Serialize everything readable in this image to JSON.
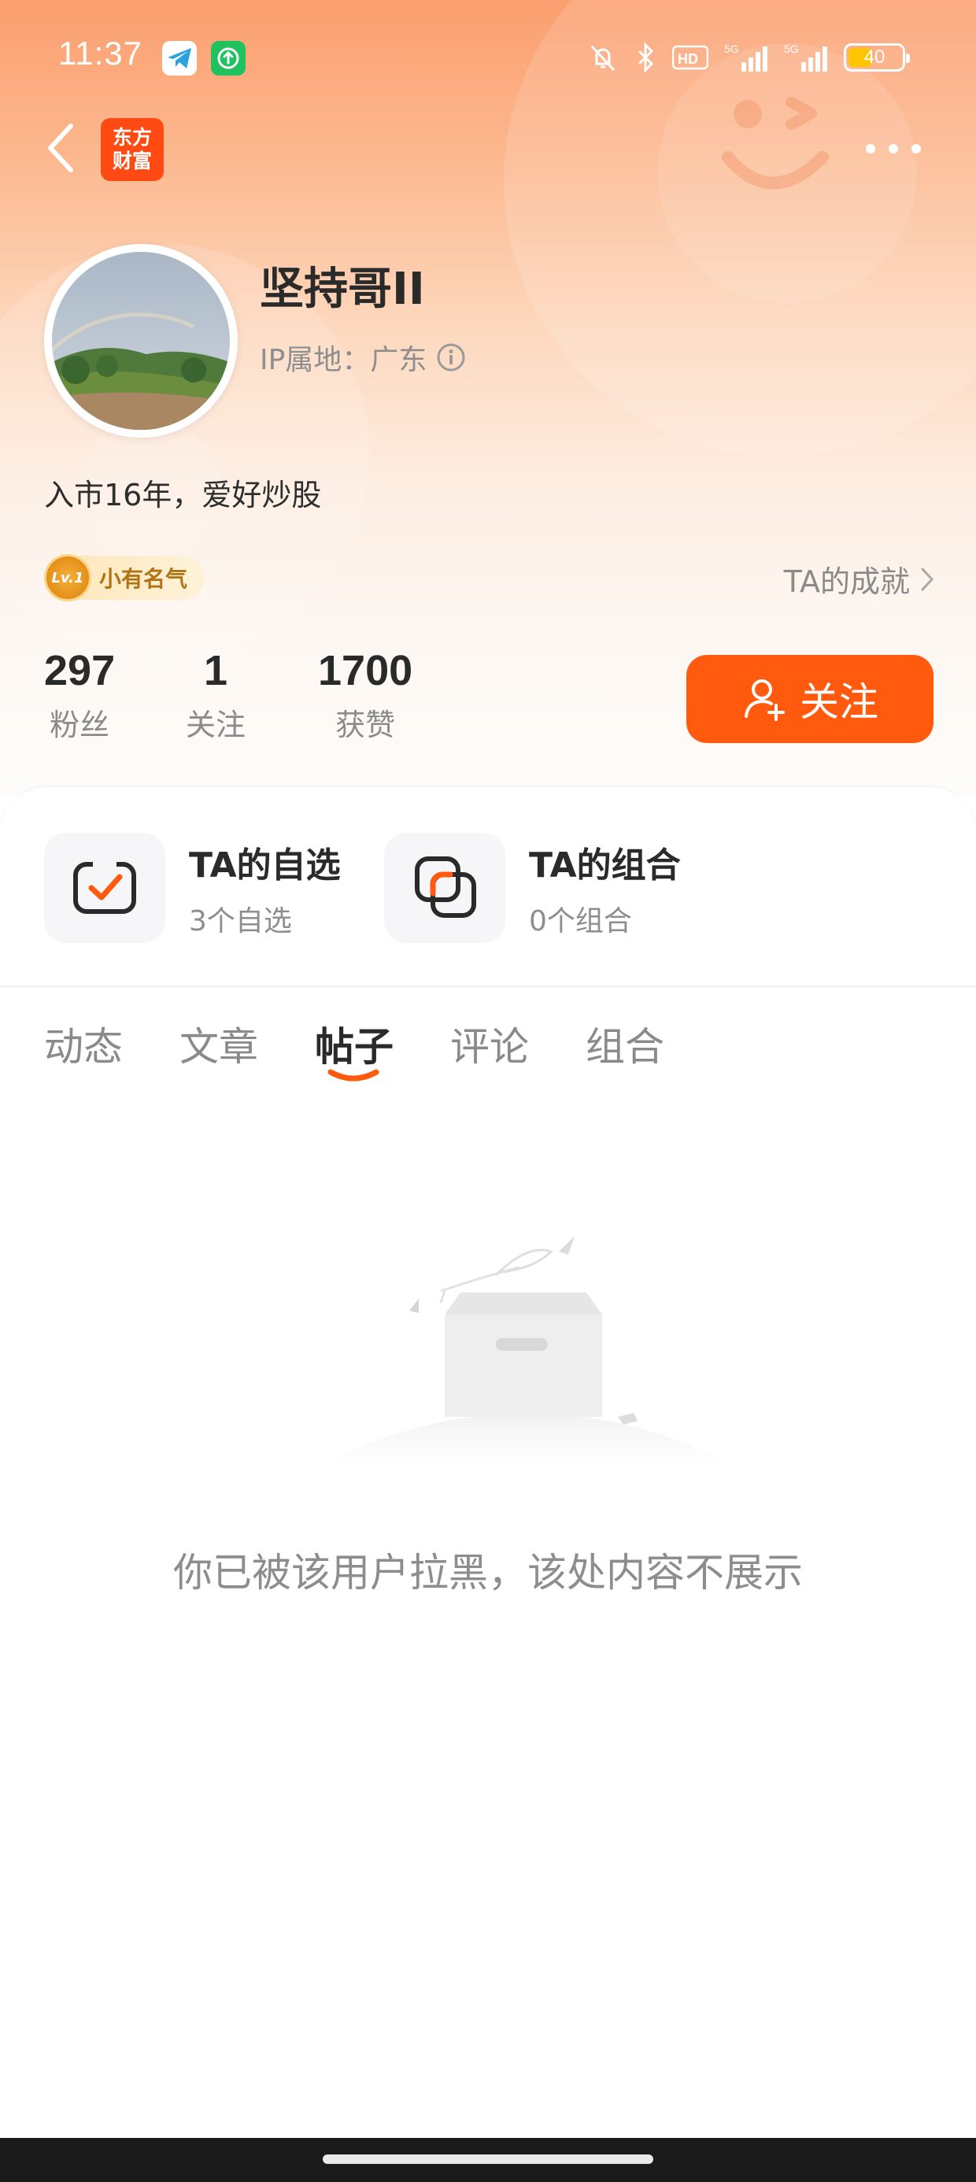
{
  "status_bar": {
    "time": "11:37",
    "battery_level": "40",
    "icons": [
      "telegram-icon",
      "upload-app-icon",
      "mute-icon",
      "bluetooth-icon",
      "hd-icon",
      "5g-signal-icon",
      "5g-signal-icon",
      "battery-icon"
    ]
  },
  "nav": {
    "logo_line1": "东方",
    "logo_line2": "财富"
  },
  "profile": {
    "name": "坚持哥II",
    "ip_location": "IP属地：广东",
    "bio": "入市16年，爱好炒股",
    "level_badge_icon_text": "Lv.1",
    "level_badge_text": "小有名气",
    "achievements_link": "TA的成就"
  },
  "stats": [
    {
      "value": "297",
      "label": "粉丝"
    },
    {
      "value": "1",
      "label": "关注"
    },
    {
      "value": "1700",
      "label": "获赞"
    }
  ],
  "follow_button_label": "关注",
  "portfolio": [
    {
      "title": "TA的自选",
      "subtitle": "3个自选"
    },
    {
      "title": "TA的组合",
      "subtitle": "0个组合"
    }
  ],
  "tabs": [
    {
      "label": "动态",
      "active": false
    },
    {
      "label": "文章",
      "active": false
    },
    {
      "label": "帖子",
      "active": true
    },
    {
      "label": "评论",
      "active": false
    },
    {
      "label": "组合",
      "active": false
    }
  ],
  "empty_state": {
    "message": "你已被该用户拉黑，该处内容不展示"
  },
  "colors": {
    "accent": "#ff5a0e",
    "header_gradient_top": "#fb9f6f",
    "logo_red": "#ff4a13"
  }
}
